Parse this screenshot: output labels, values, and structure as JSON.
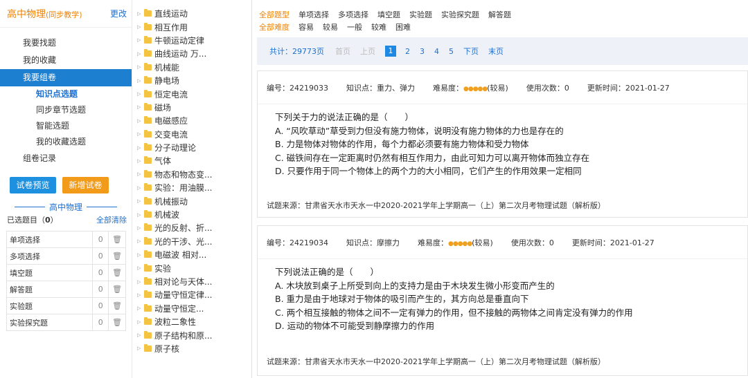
{
  "sidebar": {
    "title": "高中物理",
    "title_sub": "(同步教学)",
    "change": "更改",
    "items": [
      {
        "label": "我要找题"
      },
      {
        "label": "我的收藏"
      },
      {
        "label": "我要组卷"
      }
    ],
    "subitems": [
      {
        "label": "知识点选题"
      },
      {
        "label": "同步章节选题"
      },
      {
        "label": "智能选题"
      },
      {
        "label": "我的收藏选题"
      }
    ],
    "record": "组卷记录",
    "btn_preview": "试卷预览",
    "btn_new": "新增试卷",
    "divider": "高中物理",
    "selected_label": "已选题目",
    "selected_count": "0",
    "clear_all": "全部清除",
    "counts": [
      {
        "name": "单项选择",
        "num": "0"
      },
      {
        "name": "多项选择",
        "num": "0"
      },
      {
        "name": "填空题",
        "num": "0"
      },
      {
        "name": "解答题",
        "num": "0"
      },
      {
        "name": "实验题",
        "num": "0"
      },
      {
        "name": "实验探究题",
        "num": "0"
      }
    ]
  },
  "tree": [
    "直线运动",
    "相互作用",
    "牛顿运动定律",
    "曲线运动 万...",
    "机械能",
    "静电场",
    "恒定电流",
    "磁场",
    "电磁感应",
    "交变电流",
    "分子动理论",
    "气体",
    "物态和物态变...",
    "实验：用油膜...",
    "机械振动",
    "机械波",
    "光的反射、折...",
    "光的干涉、光...",
    "电磁波 相对...",
    "实验",
    "相对论与天体...",
    "动量守恒定律...",
    "动量守恒定...",
    "波粒二象性",
    "原子结构和原...",
    "原子核"
  ],
  "filters": {
    "types": [
      "全部题型",
      "单项选择",
      "多项选择",
      "填空题",
      "实验题",
      "实验探究题",
      "解答题"
    ],
    "difficulties": [
      "全部难度",
      "容易",
      "较易",
      "一般",
      "较难",
      "困难"
    ]
  },
  "pager": {
    "total": "共计：29773页",
    "first": "首页",
    "prev": "上页",
    "pages": [
      "1",
      "2",
      "3",
      "4",
      "5"
    ],
    "next": "下页",
    "last": "末页"
  },
  "questions": [
    {
      "id": "编号：24219033",
      "point": "知识点：重力、弹力",
      "difficulty_label": "难易度：",
      "difficulty_text": "(较易)",
      "uses": "使用次数：0",
      "updated": "更新时间：2021-01-27",
      "stem": "下列关于力的说法正确的是（　　）",
      "options": [
        "A. “风吹草动”草受到力但没有施力物体，说明没有施力物体的力也是存在的",
        "B. 力是物体对物体的作用，每个力都必须要有施力物体和受力物体",
        "C. 磁铁间存在一定距离时仍然有相互作用力，由此可知力可以离开物体而独立存在",
        "D. 只要作用于同一个物体上的两个力的大小相同，它们产生的作用效果一定相同"
      ],
      "source": "试题来源：甘肃省天水市天水一中2020-2021学年上学期高一（上）第二次月考物理试题（解析版）"
    },
    {
      "id": "编号：24219034",
      "point": "知识点：摩擦力",
      "difficulty_label": "难易度：",
      "difficulty_text": "(较易)",
      "uses": "使用次数：0",
      "updated": "更新时间：2021-01-27",
      "stem": "下列说法正确的是（　　）",
      "options": [
        "A. 木块放到桌子上所受到向上的支持力是由于木块发生微小形变而产生的",
        "B. 重力是由于地球对于物体的吸引而产生的，其方向总是垂直向下",
        "C. 两个相互接触的物体之间不一定有弹力的作用，但不接触的两物体之间肯定没有弹力的作用",
        "D. 运动的物体不可能受到静摩擦力的作用"
      ],
      "source": "试题来源：甘肃省天水市天水一中2020-2021学年上学期高一（上）第二次月考物理试题（解析版）"
    }
  ]
}
